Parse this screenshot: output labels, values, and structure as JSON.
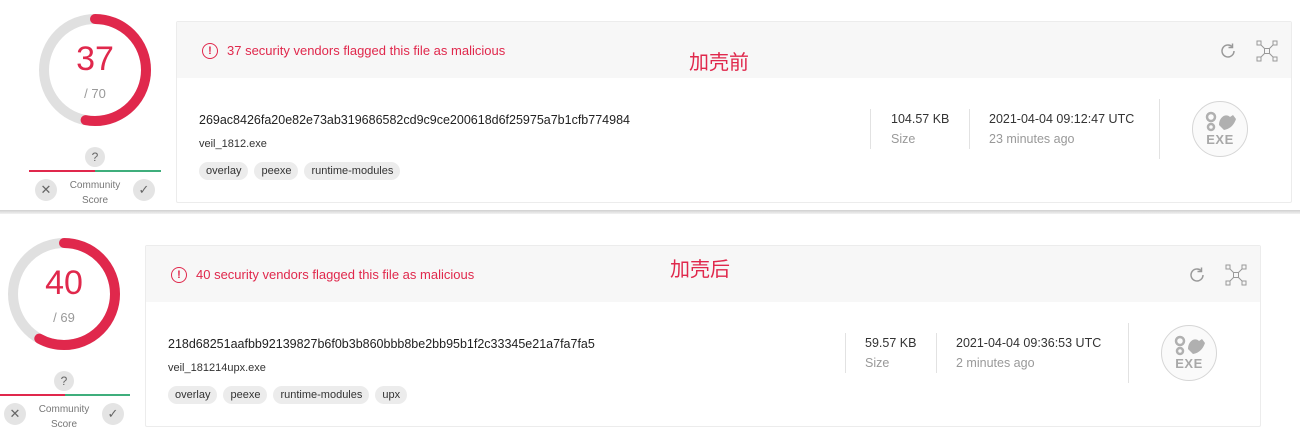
{
  "panels": [
    {
      "annotation": "加壳前",
      "detection": {
        "score": "37",
        "total": "/ 70",
        "fraction": 0.5286
      },
      "community": {
        "question": "?",
        "label_line1": "Community",
        "label_line2": "Score",
        "dismiss": "✕",
        "confirm": "✓"
      },
      "alert": {
        "icon": "!",
        "text": "37 security vendors flagged this file as malicious"
      },
      "file": {
        "hash": "269ac8426fa20e82e73ab319686582cd9c9ce200618d6f25975a7b1cfb774984",
        "name": "veil_1812.exe",
        "tags": [
          "overlay",
          "peexe",
          "runtime-modules"
        ]
      },
      "size": {
        "value": "104.57 KB",
        "label": "Size"
      },
      "date": {
        "value": "2021-04-04 09:12:47 UTC",
        "relative": "23 minutes ago"
      },
      "filetype": {
        "label": "EXE",
        "icon": "gears-icon"
      },
      "icons": [
        "alert-circle-icon",
        "refresh-icon",
        "graph-icon"
      ]
    },
    {
      "annotation": "加壳后",
      "detection": {
        "score": "40",
        "total": "/ 69",
        "fraction": 0.5797
      },
      "community": {
        "question": "?",
        "label_line1": "Community",
        "label_line2": "Score",
        "dismiss": "✕",
        "confirm": "✓"
      },
      "alert": {
        "icon": "!",
        "text": "40 security vendors flagged this file as malicious"
      },
      "file": {
        "hash": "218d68251aafbb92139827b6f0b3b860bbb8be2bb95b1f2c33345e21a7fa7fa5",
        "name": "veil_181214upx.exe",
        "tags": [
          "overlay",
          "peexe",
          "runtime-modules",
          "upx"
        ]
      },
      "size": {
        "value": "59.57 KB",
        "label": "Size"
      },
      "date": {
        "value": "2021-04-04 09:36:53 UTC",
        "relative": "2 minutes ago"
      },
      "filetype": {
        "label": "EXE",
        "icon": "gears-icon"
      },
      "icons": [
        "alert-circle-icon",
        "refresh-icon",
        "graph-icon"
      ]
    }
  ],
  "colors": {
    "malicious": "#e0284c",
    "harmless": "#3fae7c",
    "track": "#e0e0e0"
  }
}
